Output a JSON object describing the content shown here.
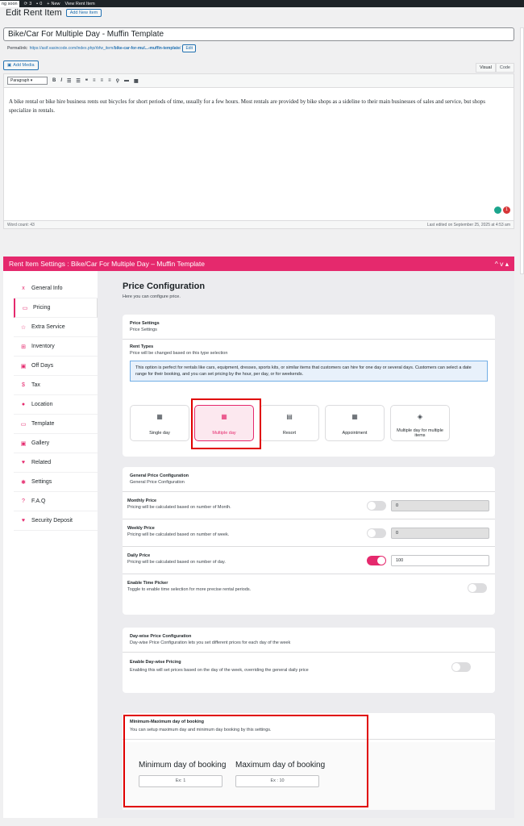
{
  "adminbar": {
    "soon": "ng soon",
    "updates": "3",
    "comments": "0",
    "new": "New",
    "view": "View Rent Item"
  },
  "heading": {
    "title": "Edit Rent Item",
    "add_new": "Add New Item"
  },
  "post": {
    "title": "Bike/Car For Multiple Day - Muffin Template",
    "permalink_label": "Permalink:",
    "permalink_url": "https://asif.vasincode.com/index.php/rbfw_item/",
    "permalink_slug": "bike-car-for-mul...-muffin-template",
    "permalink_tail": "/",
    "edit": "Edit"
  },
  "editor": {
    "add_media": "Add Media",
    "tab_visual": "Visual",
    "tab_code": "Code",
    "format": "Paragraph",
    "content": "A bike rental or bike hire business rents out bicycles for short periods of time, usually for a few hours. Most rentals are provided by bike shops as a sideline to their main businesses of sales and service, but shops specialize in rentals.",
    "word_count": "Word count: 43",
    "last_edited": "Last edited on September 25, 2025 at 4:53 am",
    "grammarly_count": "1"
  },
  "settings": {
    "title": "Rent Item Settings : Bike/Car For Multiple Day – Muffin Template",
    "arrows": "^ v ▴"
  },
  "nav": [
    {
      "label": "General Info",
      "icon": "x"
    },
    {
      "label": "Pricing",
      "icon": "▭"
    },
    {
      "label": "Extra Service",
      "icon": "☆"
    },
    {
      "label": "Inventory",
      "icon": "⊞"
    },
    {
      "label": "Off Days",
      "icon": "▣"
    },
    {
      "label": "Tax",
      "icon": "$"
    },
    {
      "label": "Location",
      "icon": "●"
    },
    {
      "label": "Template",
      "icon": "▭"
    },
    {
      "label": "Gallery",
      "icon": "▣"
    },
    {
      "label": "Related",
      "icon": "♥"
    },
    {
      "label": "Settings",
      "icon": "✱"
    },
    {
      "label": "F.A.Q",
      "icon": "?"
    },
    {
      "label": "Security Deposit",
      "icon": "♥"
    }
  ],
  "price": {
    "heading": "Price Configuration",
    "sub": "Here you can configure price.",
    "settings_title": "Price Settings",
    "settings_desc": "Price Settings",
    "rent_types_title": "Rent Types",
    "rent_types_desc": "Price will be changed based on this type selection",
    "info": "This option is perfect for rentals like cars, equipment, dresses, sports kits, or similar items that customers can hire for one day or several days. Customers can select a date range for their booking, and you can set pricing by the hour, per day, or for weekends.",
    "types": [
      "Single day",
      "Multiple day",
      "Resort",
      "Appointment",
      "Multiple day for multiple items"
    ],
    "general_title": "General Price Configuration",
    "general_desc": "General Price Configuration",
    "monthly_title": "Monthly Price",
    "monthly_desc": "Pricing will be calculated based on number of Month.",
    "monthly_value": "0",
    "weekly_title": "Weekly Price",
    "weekly_desc": "Pricing will be calculated based on number of week.",
    "weekly_value": "0",
    "daily_title": "Daily Price",
    "daily_desc": "Pricing will be calculated based on number of day.",
    "daily_value": "100",
    "time_title": "Enable Time Picker",
    "time_desc": "Toggle to enable time selection for more precise rental periods.",
    "daywise_title": "Day-wise Price Configuration",
    "daywise_desc": "Day-wise Price Configuration lets you set different prices for each day of the week",
    "enable_daywise_title": "Enable Day-wise Pricing",
    "enable_daywise_desc": "Enabling this will set prices based on the day of the week, overriding the general daily price",
    "minmax_title": "Minimum-Maximum day of booking",
    "minmax_desc": "You can setup maximum day and minimum day booking by this settings.",
    "min_label": "Minimum day of booking",
    "min_placeholder": "Ex: 1",
    "max_label": "Maximum day of booking",
    "max_placeholder": "Ex : 10"
  }
}
